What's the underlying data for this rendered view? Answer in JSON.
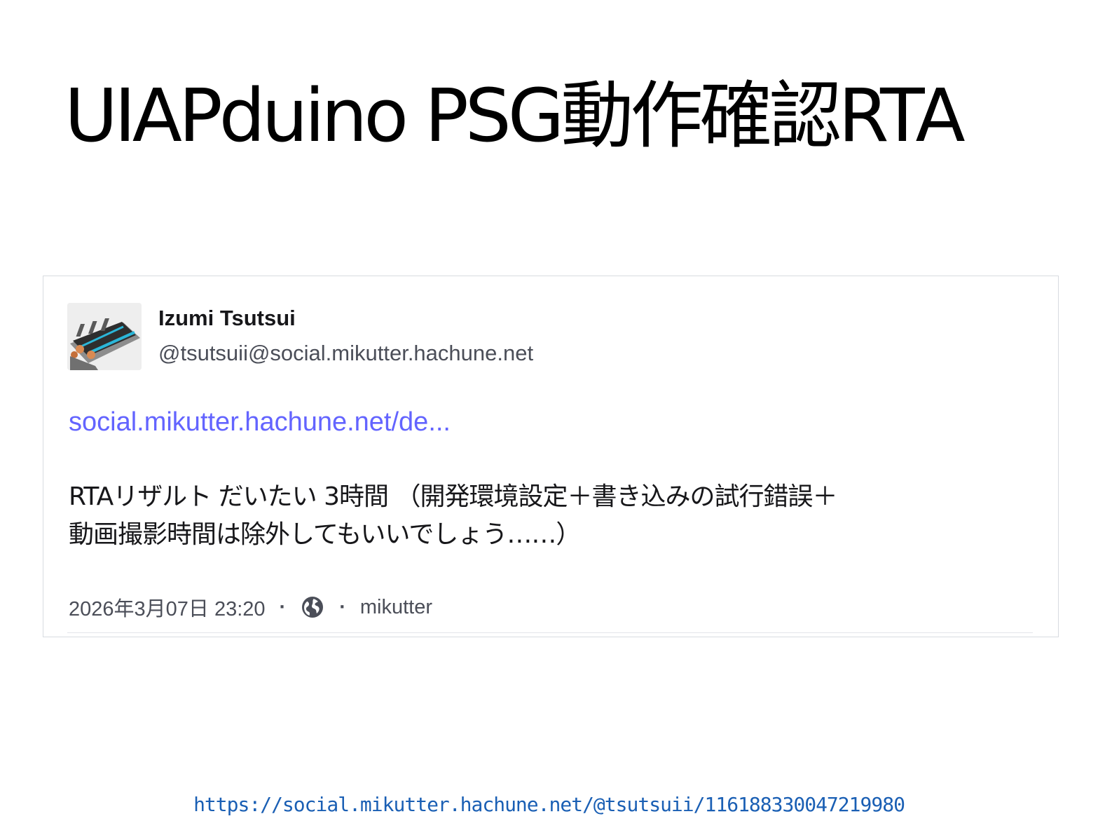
{
  "slide": {
    "title": "UIAPduino PSG動作確認RTA"
  },
  "post": {
    "author_name": "Izumi Tsutsui",
    "author_handle": "@tsutsuii@social.mikutter.hachune.net",
    "link_text": "social.mikutter.hachune.net/de...",
    "content_lines": [
      "RTAリザルト だいたい 3時間 （開発環境設定＋書き込みの試行錯誤＋",
      "動画撮影時間は除外してもいいでしょう……）"
    ],
    "timestamp": "2026年3月07日 23:20",
    "separator": "·",
    "visibility_icon": "globe-icon",
    "application": "mikutter"
  },
  "footer": {
    "source_url": "https://social.mikutter.hachune.net/@tsutsuii/116188330047219980"
  },
  "colors": {
    "link": "#6364ff",
    "source_url": "#1a5fb4",
    "card_border": "#d8dbe0",
    "secondary_text": "#4b4e58"
  }
}
